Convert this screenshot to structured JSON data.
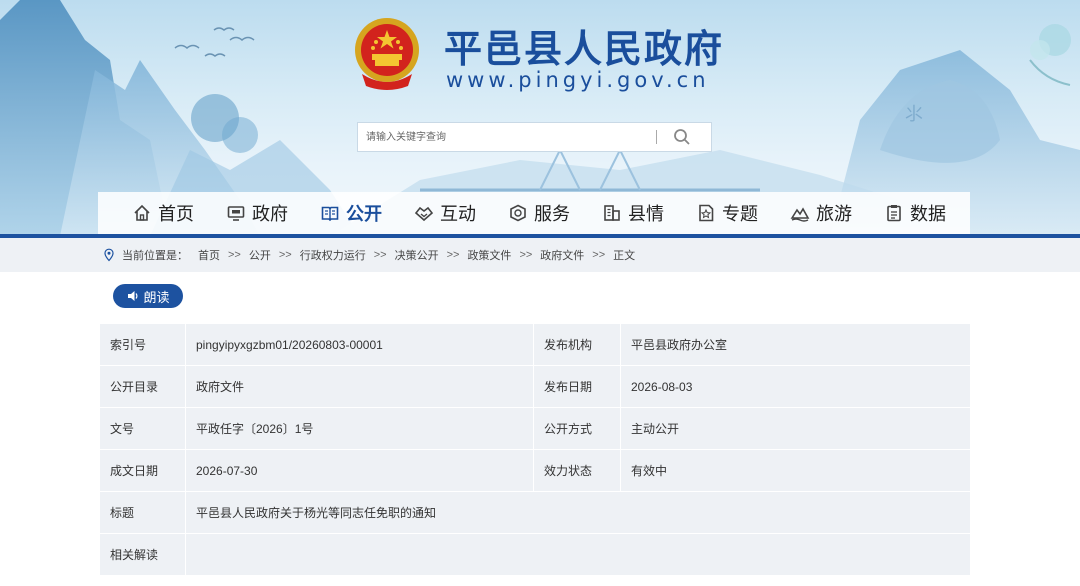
{
  "header": {
    "site_title": "平邑县人民政府",
    "site_url": "www.pingyi.gov.cn",
    "search": {
      "placeholder": "请输入关键字查询",
      "value": ""
    }
  },
  "nav": {
    "items": [
      {
        "label": "首页",
        "icon": "home-icon"
      },
      {
        "label": "政府",
        "icon": "monitor-icon"
      },
      {
        "label": "公开",
        "icon": "book-icon",
        "active": true
      },
      {
        "label": "互动",
        "icon": "handshake-icon"
      },
      {
        "label": "服务",
        "icon": "service-icon"
      },
      {
        "label": "县情",
        "icon": "building-icon"
      },
      {
        "label": "专题",
        "icon": "star-doc-icon"
      },
      {
        "label": "旅游",
        "icon": "mountain-icon"
      },
      {
        "label": "数据",
        "icon": "clipboard-icon"
      }
    ],
    "accent_color": "#1d52a0"
  },
  "breadcrumb": {
    "prefix": "当前位置是：",
    "separator": ">>",
    "items": [
      "首页",
      "公开",
      "行政权力运行",
      "决策公开",
      "政策文件",
      "政府文件",
      "正文"
    ]
  },
  "read_button": {
    "label": "朗读"
  },
  "info_table": {
    "rows": [
      {
        "k1": "索引号",
        "v1": "pingyipyxgzbm01/20260803-00001",
        "k2": "发布机构",
        "v2": "平邑县政府办公室"
      },
      {
        "k1": "公开目录",
        "v1": "政府文件",
        "k2": "发布日期",
        "v2": "2026-08-03"
      },
      {
        "k1": "文号",
        "v1": "平政任字〔2026〕1号",
        "k2": "公开方式",
        "v2": "主动公开"
      },
      {
        "k1": "成文日期",
        "v1": "2026-07-30",
        "k2": "效力状态",
        "v2": "有效中"
      }
    ],
    "title_label": "标题",
    "title_value": "平邑县人民政府关于杨光等同志任免职的通知",
    "related_label": "相关解读",
    "related_value": ""
  }
}
